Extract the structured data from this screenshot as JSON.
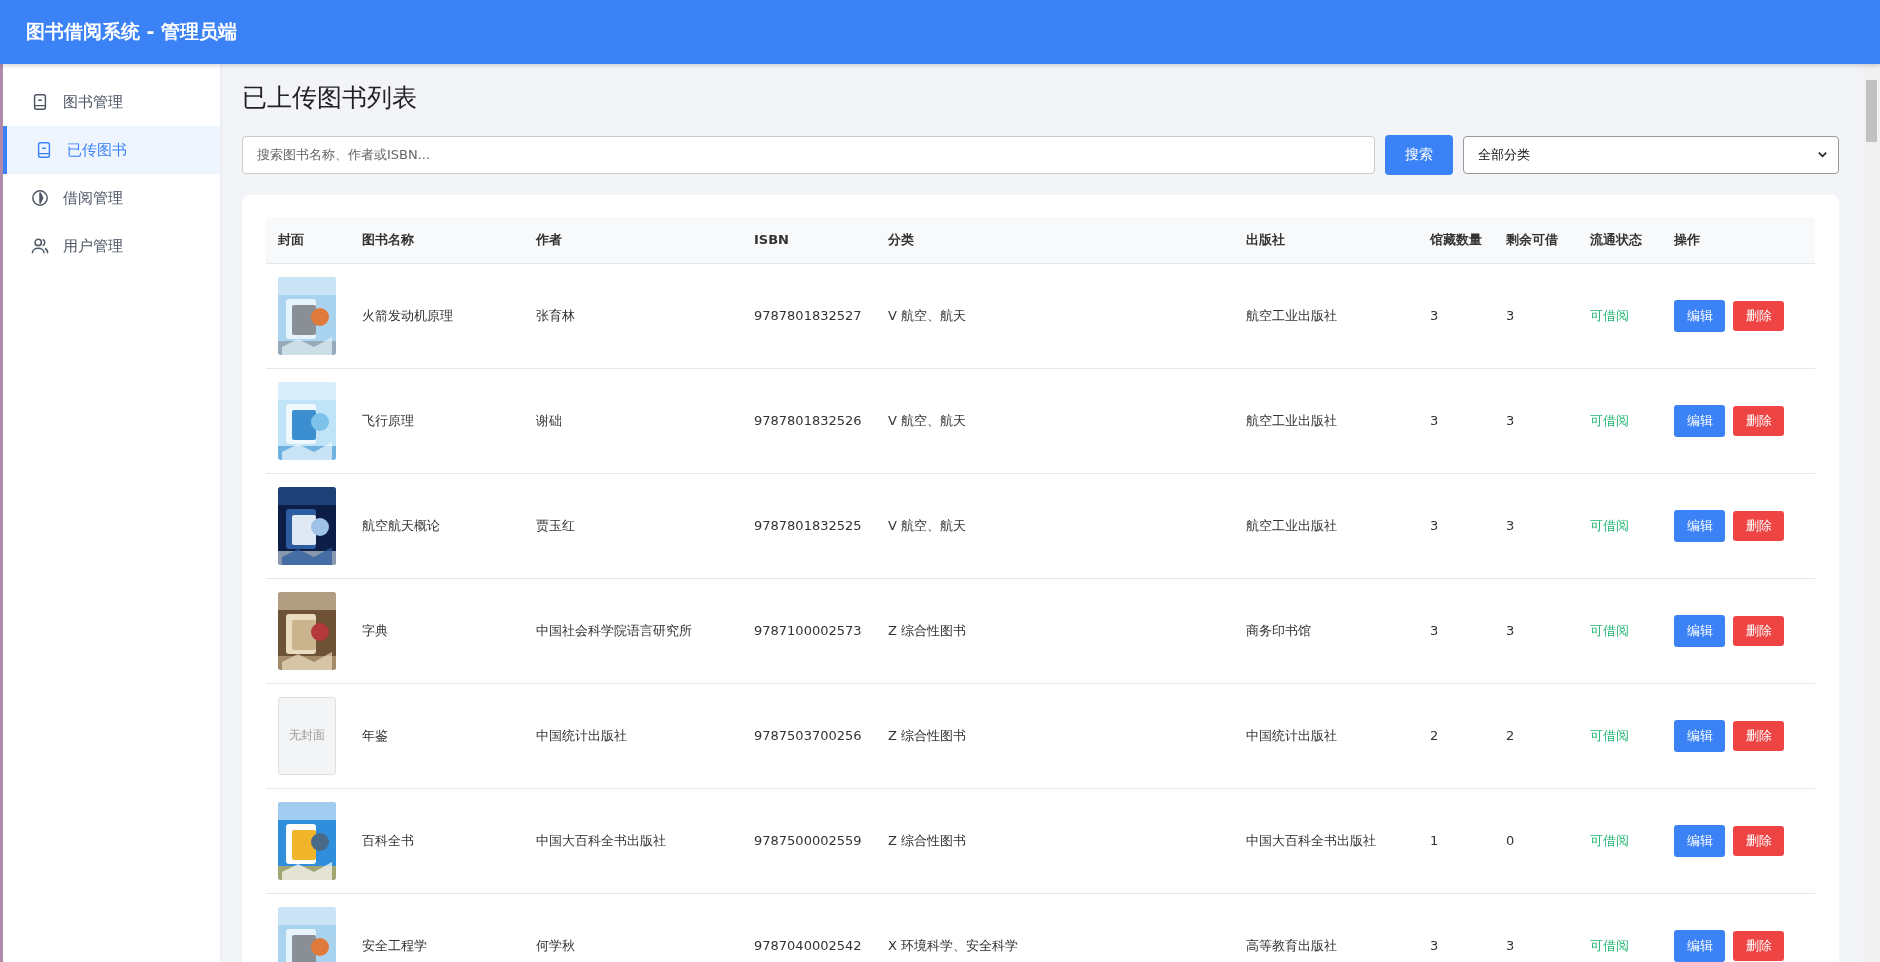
{
  "header": {
    "title": "图书借阅系统 - 管理员端"
  },
  "sidebar": {
    "items": [
      {
        "label": "图书管理",
        "kind": "book",
        "selected": false
      },
      {
        "label": "已传图书",
        "kind": "book",
        "selected": true
      },
      {
        "label": "借阅管理",
        "kind": "circle",
        "selected": false
      },
      {
        "label": "用户管理",
        "kind": "users",
        "selected": false
      }
    ]
  },
  "page_title": "已上传图书列表",
  "search": {
    "placeholder": "搜索图书名称、作者或ISBN...",
    "button": "搜索",
    "category_select": "全部分类"
  },
  "table": {
    "columns": [
      "封面",
      "图书名称",
      "作者",
      "ISBN",
      "分类",
      "出版社",
      "馆藏数量",
      "剩余可借",
      "流通状态",
      "操作"
    ],
    "rows": [
      {
        "title": "火箭发动机原理",
        "author": "张育林",
        "isbn": "9787801832527",
        "category": "V 航空、航天",
        "publisher": "航空工业出版社",
        "total": "3",
        "available": "3",
        "status": "可借阅",
        "actions": [
          "编辑",
          "删除"
        ]
      },
      {
        "title": "飞行原理",
        "author": "谢础",
        "isbn": "9787801832526",
        "category": "V 航空、航天",
        "publisher": "航空工业出版社",
        "total": "3",
        "available": "3",
        "status": "可借阅",
        "actions": [
          "编辑",
          "删除"
        ]
      },
      {
        "title": "航空航天概论",
        "author": "贾玉红",
        "isbn": "9787801832525",
        "category": "V 航空、航天",
        "publisher": "航空工业出版社",
        "total": "3",
        "available": "3",
        "status": "可借阅",
        "actions": [
          "编辑",
          "删除"
        ]
      },
      {
        "title": "字典",
        "author": "中国社会科学院语言研究所",
        "isbn": "9787100002573",
        "category": "Z 综合性图书",
        "publisher": "商务印书馆",
        "total": "3",
        "available": "3",
        "status": "可借阅",
        "actions": [
          "编辑",
          "删除"
        ]
      },
      {
        "cover": {
          "kind": "empty",
          "text": "无封面"
        },
        "title": "年鉴",
        "author": "中国统计出版社",
        "isbn": "9787503700256",
        "category": "Z 综合性图书",
        "publisher": "中国统计出版社",
        "total": "2",
        "available": "2",
        "status": "可借阅",
        "actions": [
          "编辑",
          "删除"
        ]
      },
      {
        "title": "百科全书",
        "author": "中国大百科全书出版社",
        "isbn": "9787500002559",
        "category": "Z 综合性图书",
        "publisher": "中国大百科全书出版社",
        "total": "1",
        "available": "0",
        "status": "可借阅",
        "actions": [
          "编辑",
          "删除"
        ]
      },
      {
        "title": "安全工程学",
        "author": "何学秋",
        "isbn": "9787040002542",
        "category": "X 环境科学、安全科学",
        "publisher": "高等教育出版社",
        "total": "3",
        "available": "3",
        "status": "可借阅",
        "actions": [
          "编辑",
          "删除"
        ]
      }
    ]
  }
}
